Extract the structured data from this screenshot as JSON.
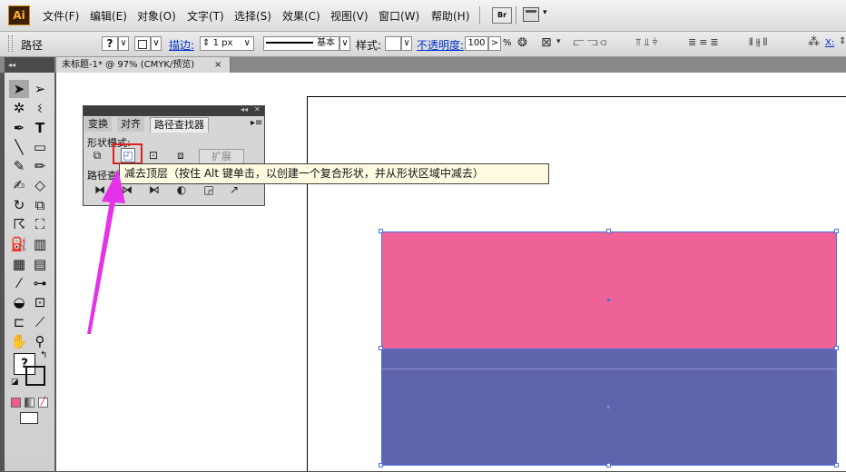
{
  "app": {
    "logo": "Ai"
  },
  "menu": [
    "文件(F)",
    "编辑(E)",
    "对象(O)",
    "文字(T)",
    "选择(S)",
    "效果(C)",
    "视图(V)",
    "窗口(W)",
    "帮助(H)"
  ],
  "menubar_right": {
    "bridge": "Br",
    "dropdown": "▾"
  },
  "control_bar": {
    "selection": "路径",
    "fill_symbol": "?",
    "stroke_label": "描边:",
    "stroke_weight": "1 px",
    "stroke_profile": "基本",
    "style_label": "样式:",
    "opacity_label": "不透明度:",
    "opacity_value": "100",
    "opacity_unit": "%",
    "x_label": "X:"
  },
  "document_tab": {
    "title": "未标题-1* @ 97% (CMYK/预览)",
    "close": "×"
  },
  "tools": {
    "panel_collapse": "◂◂",
    "fill_box_symbol": "?",
    "icons": [
      "selection-tool",
      "direct-selection-tool",
      "magic-wand-tool",
      "lasso-tool",
      "pen-tool",
      "type-tool",
      "line-tool",
      "rectangle-tool",
      "paintbrush-tool",
      "pencil-tool",
      "blob-brush-tool",
      "eraser-tool",
      "rotate-tool",
      "scale-tool",
      "warp-tool",
      "free-transform-tool",
      "symbol-sprayer-tool",
      "column-graph-tool",
      "mesh-tool",
      "gradient-tool",
      "eyedropper-tool",
      "blend-tool",
      "live-paint-bucket-tool",
      "live-paint-selection-tool",
      "artboard-tool",
      "slice-tool",
      "hand-tool",
      "zoom-tool"
    ]
  },
  "pathfinder": {
    "tabs": [
      "变换",
      "对齐",
      "路径查找器"
    ],
    "shape_modes_label": "形状模式:",
    "expand_label": "扩展",
    "pathfinders_label": "路径查"
  },
  "tooltip": {
    "text": "减去顶层（按住 Alt 键单击，以创建一个复合形状，并从形状区域中减去）"
  },
  "colors": {
    "pink_rect": "#ee6298",
    "blue_rect": "#6064ad",
    "highlight_box": "#e02020",
    "arrow": "#e532e8",
    "selection": "#4a6fe0"
  }
}
